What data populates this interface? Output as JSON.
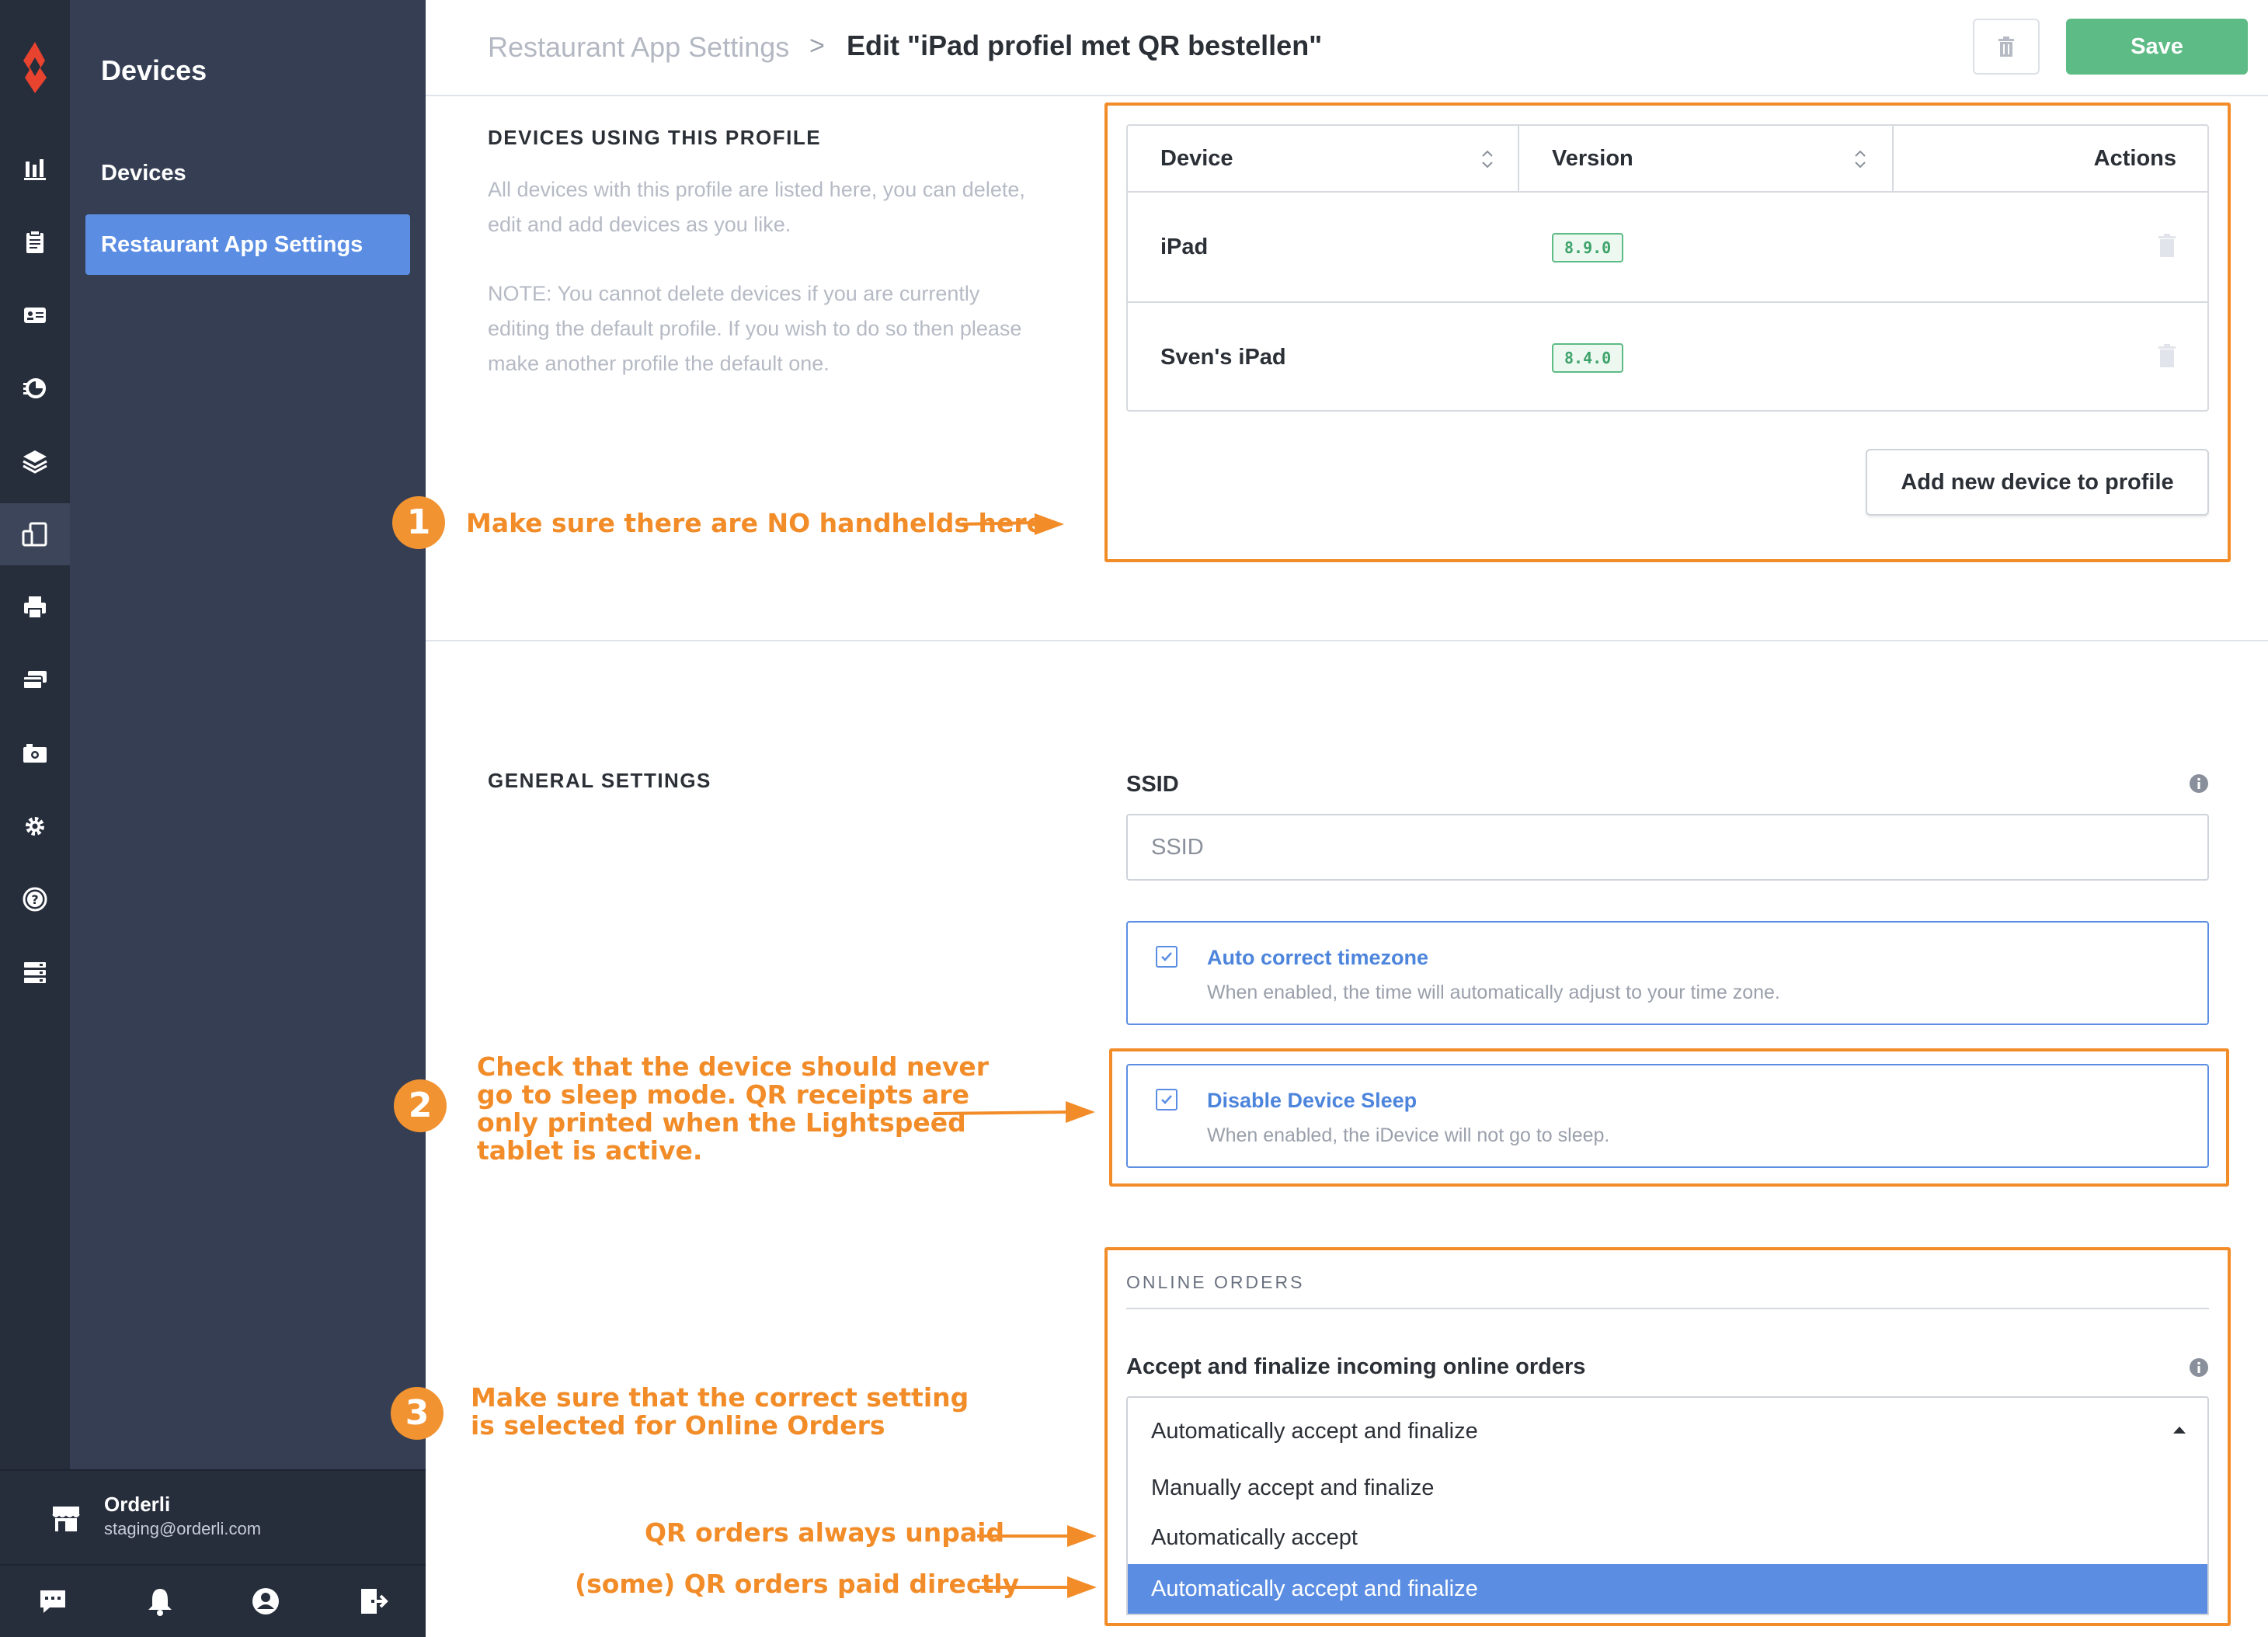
{
  "nav": {
    "title": "Devices",
    "items": [
      {
        "label": "Devices",
        "active": false
      },
      {
        "label": "Restaurant App Settings",
        "active": true
      }
    ]
  },
  "rail_icons": [
    "reports-icon",
    "clipboard-icon",
    "id-card-icon",
    "pie-history-icon",
    "layers-icon",
    "devices-icon",
    "printer-icon",
    "cards-icon",
    "cash-register-icon",
    "gear-icon",
    "help-icon",
    "server-icon"
  ],
  "account": {
    "name": "Orderli",
    "email": "staging@orderli.com"
  },
  "footer_icons": [
    "chat-icon",
    "bell-icon",
    "user-icon",
    "logout-icon"
  ],
  "header": {
    "breadcrumb_parent": "Restaurant App Settings",
    "breadcrumb_separator": ">",
    "breadcrumb_current": "Edit \"iPad profiel met QR bestellen\"",
    "save_label": "Save"
  },
  "devices_section": {
    "title": "DEVICES USING THIS PROFILE",
    "description": "All devices with this profile are listed here, you can delete, edit and add devices as you like.",
    "note": "NOTE: You cannot delete devices if you are currently editing the default profile. If you wish to do so then please make another profile the default one.",
    "columns": {
      "device": "Device",
      "version": "Version",
      "actions": "Actions"
    },
    "rows": [
      {
        "device": "iPad",
        "version": "8.9.0"
      },
      {
        "device": "Sven's iPad",
        "version": "8.4.0"
      }
    ],
    "add_button": "Add new device to profile"
  },
  "general_section": {
    "title": "GENERAL SETTINGS",
    "ssid_label": "SSID",
    "ssid_placeholder": "SSID",
    "ssid_value": "",
    "auto_timezone": {
      "title": "Auto correct timezone",
      "desc": "When enabled, the time will automatically adjust to your time zone.",
      "checked": true
    },
    "disable_sleep": {
      "title": "Disable Device Sleep",
      "desc": "When enabled, the iDevice will not go to sleep.",
      "checked": true
    }
  },
  "online_orders": {
    "title": "ONLINE ORDERS",
    "label": "Accept and finalize incoming online orders",
    "selected": "Automatically accept and finalize",
    "options": [
      "Manually accept and finalize",
      "Automatically accept",
      "Automatically accept and finalize"
    ]
  },
  "annotations": {
    "a1": {
      "num": "1",
      "text": "Make sure there are NO handhelds here"
    },
    "a2": {
      "num": "2",
      "text": "Check that the device should never\ngo to sleep mode. QR receipts are\nonly printed when the Lightspeed\ntablet is active."
    },
    "a3": {
      "num": "3",
      "text": "Make sure that the correct setting\nis selected for Online Orders"
    },
    "a4": {
      "text": "QR orders always unpaid"
    },
    "a5": {
      "text": "(some) QR orders paid directly"
    }
  },
  "colors": {
    "accent": "#5b8ee3",
    "save": "#5dbb85",
    "annotation": "#f28c28",
    "sidebar": "#353e53",
    "rail": "#262d3b"
  }
}
